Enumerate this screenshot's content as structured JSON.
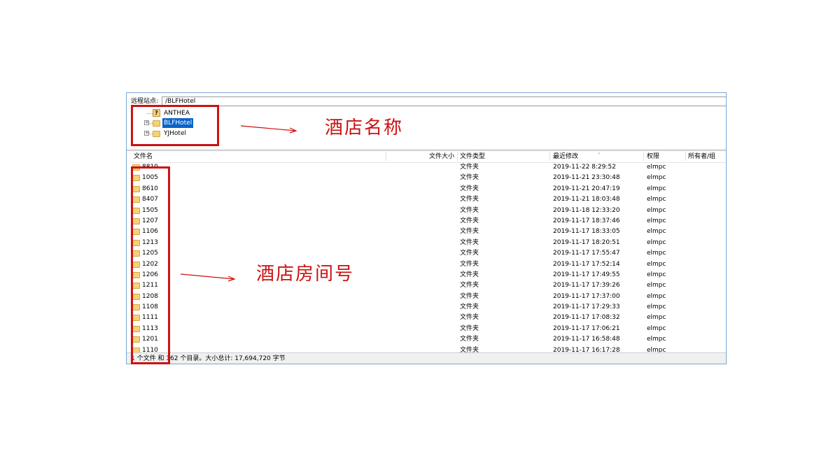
{
  "path_bar": {
    "label": "远程站点:",
    "value": "/BLFHotel"
  },
  "tree": {
    "nodes": [
      {
        "label": "ANTHEA",
        "icon": "question-folder-icon"
      },
      {
        "label": "BLFHotel",
        "icon": "folder-icon",
        "selected": true
      },
      {
        "label": "YJHotel",
        "icon": "folder-icon"
      }
    ]
  },
  "columns": {
    "name": "文件名",
    "size": "文件大小",
    "type": "文件类型",
    "modified": "最近修改",
    "permissions": "权限",
    "owner": "所有者/组"
  },
  "rows": [
    {
      "name": "8810",
      "type": "文件夹",
      "modified": "2019-11-22 8:29:52",
      "perm": "elmpc"
    },
    {
      "name": "1005",
      "type": "文件夹",
      "modified": "2019-11-21 23:30:48",
      "perm": "elmpc"
    },
    {
      "name": "8610",
      "type": "文件夹",
      "modified": "2019-11-21 20:47:19",
      "perm": "elmpc"
    },
    {
      "name": "8407",
      "type": "文件夹",
      "modified": "2019-11-21 18:03:48",
      "perm": "elmpc"
    },
    {
      "name": "1505",
      "type": "文件夹",
      "modified": "2019-11-18 12:33:20",
      "perm": "elmpc"
    },
    {
      "name": "1207",
      "type": "文件夹",
      "modified": "2019-11-17 18:37:46",
      "perm": "elmpc"
    },
    {
      "name": "1106",
      "type": "文件夹",
      "modified": "2019-11-17 18:33:05",
      "perm": "elmpc"
    },
    {
      "name": "1213",
      "type": "文件夹",
      "modified": "2019-11-17 18:20:51",
      "perm": "elmpc"
    },
    {
      "name": "1205",
      "type": "文件夹",
      "modified": "2019-11-17 17:55:47",
      "perm": "elmpc"
    },
    {
      "name": "1202",
      "type": "文件夹",
      "modified": "2019-11-17 17:52:14",
      "perm": "elmpc"
    },
    {
      "name": "1206",
      "type": "文件夹",
      "modified": "2019-11-17 17:49:55",
      "perm": "elmpc"
    },
    {
      "name": "1211",
      "type": "文件夹",
      "modified": "2019-11-17 17:39:26",
      "perm": "elmpc"
    },
    {
      "name": "1208",
      "type": "文件夹",
      "modified": "2019-11-17 17:37:00",
      "perm": "elmpc"
    },
    {
      "name": "1108",
      "type": "文件夹",
      "modified": "2019-11-17 17:29:33",
      "perm": "elmpc"
    },
    {
      "name": "1111",
      "type": "文件夹",
      "modified": "2019-11-17 17:08:32",
      "perm": "elmpc"
    },
    {
      "name": "1113",
      "type": "文件夹",
      "modified": "2019-11-17 17:06:21",
      "perm": "elmpc"
    },
    {
      "name": "1201",
      "type": "文件夹",
      "modified": "2019-11-17 16:58:48",
      "perm": "elmpc"
    },
    {
      "name": "1110",
      "type": "文件夹",
      "modified": "2019-11-17 16:17:28",
      "perm": "elmpc"
    }
  ],
  "status": "1 个文件 和 162 个目录。大小总计: 17,694,720 字节",
  "annotations": {
    "hotel_name": "酒店名称",
    "room_number": "酒店房间号"
  },
  "colors": {
    "annotation_red": "#cc1111",
    "selection_blue": "#0a64c8",
    "folder_yellow": "#f6d275"
  }
}
